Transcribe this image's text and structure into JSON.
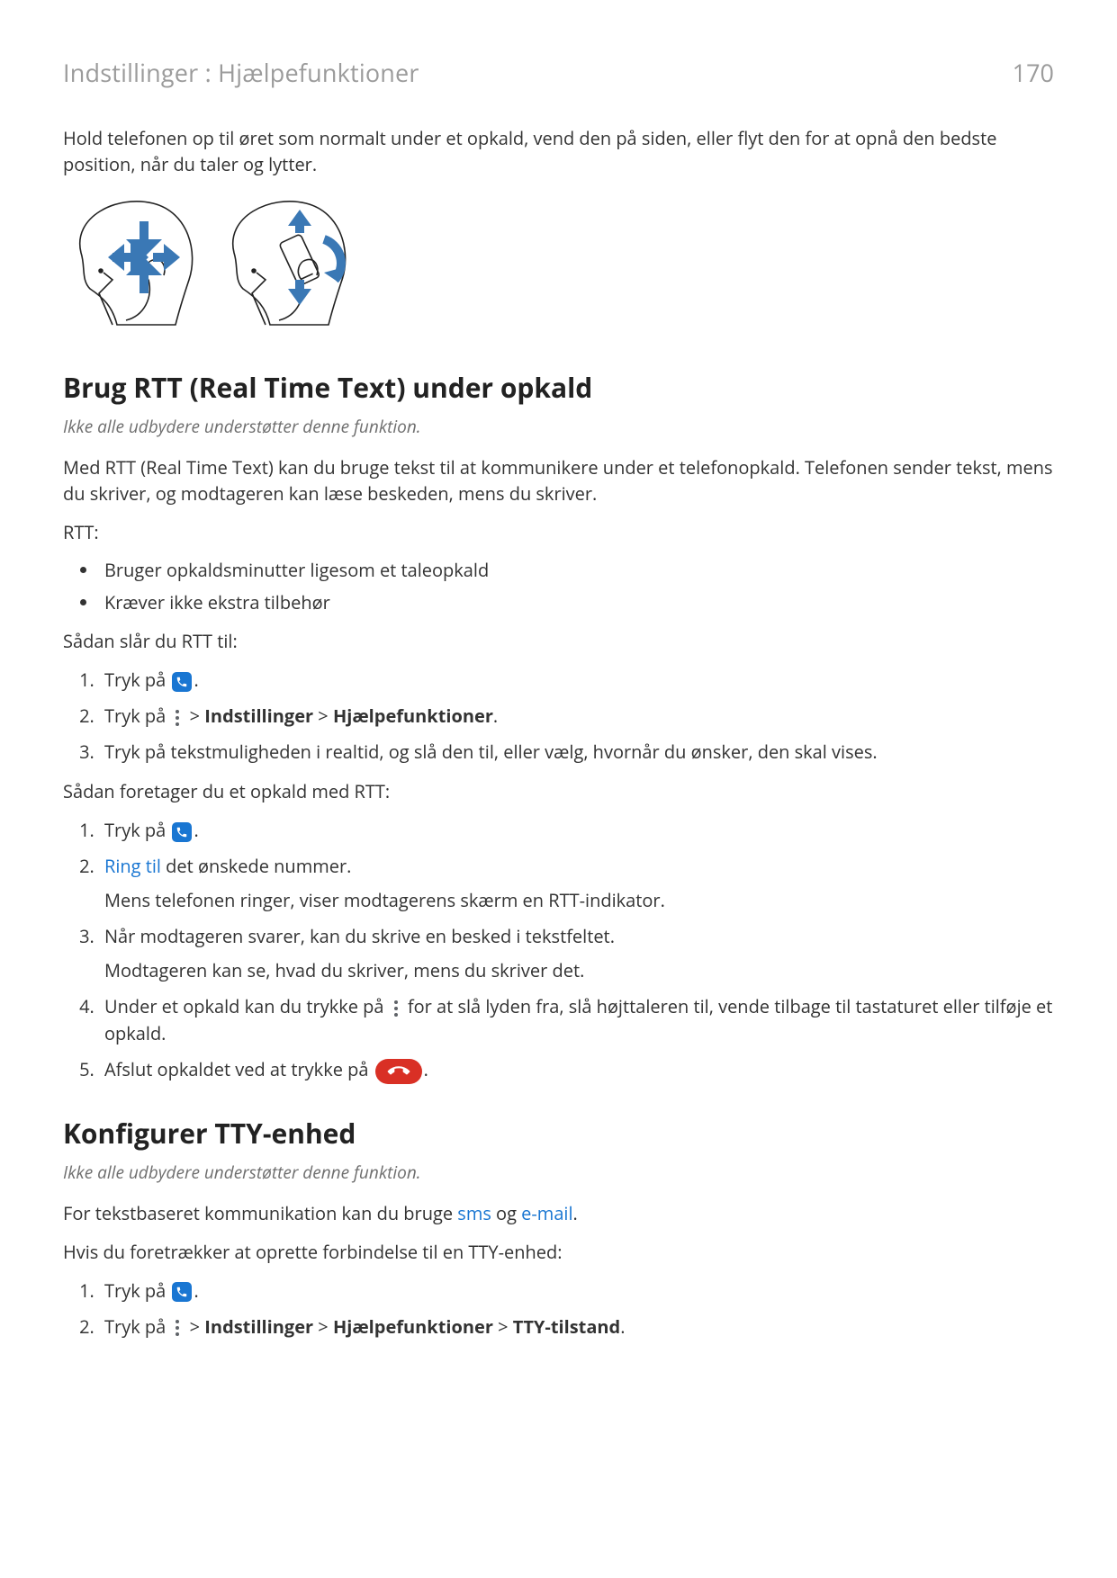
{
  "header": {
    "breadcrumb": "Indstillinger : Hjælpefunktioner",
    "page_number": "170"
  },
  "intro_para": "Hold telefonen op til øret som normalt under et opkald, vend den på siden, eller flyt den for at opnå den bedste position, når du taler og lytter.",
  "section_rtt": {
    "title": "Brug RTT (Real Time Text) under opkald",
    "note": "Ikke alle udbydere understøtter denne funktion.",
    "desc": "Med RTT (Real Time Text) kan du bruge tekst til at kommunikere under et telefonopkald. Telefonen sender tekst, mens du skriver, og modtageren kan læse beskeden, mens du skriver.",
    "list_label": "RTT:",
    "bullets": {
      "b1": "Bruger opkaldsminutter ligesom et taleopkald",
      "b2": "Kræver ikke ekstra tilbehør"
    },
    "enable_label": "Sådan slår du RTT til:",
    "enable_steps": {
      "s1_pre": "Tryk på ",
      "s1_post": ".",
      "s2_pre": "Tryk på ",
      "s2_gt1": " > ",
      "s2_b1": "Indstillinger",
      "s2_gt2": " > ",
      "s2_b2": "Hjælpefunktioner",
      "s2_post": ".",
      "s3": "Tryk på tekstmuligheden i realtid, og slå den til, eller vælg, hvornår du ønsker, den skal vises."
    },
    "call_label": "Sådan foretager du et opkald med RTT:",
    "call_steps": {
      "s1_pre": "Tryk på ",
      "s1_post": ".",
      "s2_link": "Ring til",
      "s2_rest": " det ønskede nummer.",
      "s2_sub": "Mens telefonen ringer, viser modtagerens skærm en RTT-indikator.",
      "s3_main": "Når modtageren svarer, kan du skrive en besked i tekstfeltet.",
      "s3_sub": "Modtageren kan se, hvad du skriver, mens du skriver det.",
      "s4_pre": "Under et opkald kan du trykke på ",
      "s4_post": " for at slå lyden fra, slå højttaleren til, vende tilbage til tastaturet eller tilføje et opkald.",
      "s5_pre": "Afslut opkaldet ved at trykke på ",
      "s5_post": "."
    }
  },
  "section_tty": {
    "title": "Konfigurer TTY-enhed",
    "note": "Ikke alle udbydere understøtter denne funktion.",
    "p1_pre": "For tekstbaseret kommunikation kan du bruge ",
    "p1_link1": "sms",
    "p1_mid": " og ",
    "p1_link2": "e-mail",
    "p1_post": ".",
    "p2": "Hvis du foretrækker at oprette forbindelse til en TTY-enhed:",
    "steps": {
      "s1_pre": "Tryk på ",
      "s1_post": ".",
      "s2_pre": "Tryk på ",
      "s2_gt1": " > ",
      "s2_b1": "Indstillinger",
      "s2_gt2": " > ",
      "s2_b2": "Hjælpefunktioner",
      "s2_gt3": " > ",
      "s2_b3": "TTY-tilstand",
      "s2_post": "."
    }
  }
}
